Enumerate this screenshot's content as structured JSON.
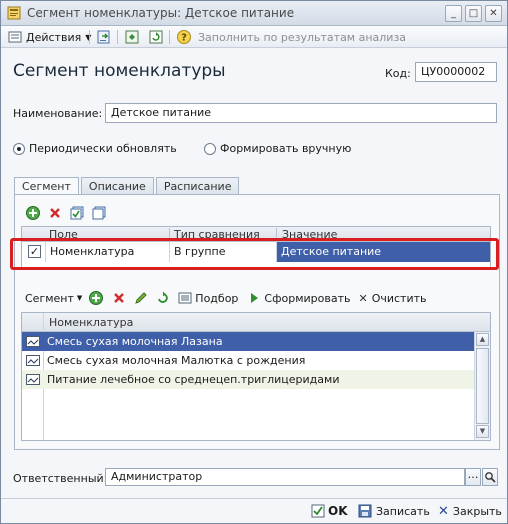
{
  "window": {
    "title": "Сегмент номенклатуры: Детское питание",
    "controls": [
      "minimize",
      "maximize",
      "close"
    ]
  },
  "toolbar": {
    "actions_label": "Действия",
    "fill_label": "Заполнить по результатам анализа"
  },
  "form": {
    "heading": "Сегмент номенклатуры",
    "code_label": "Код:",
    "code_value": "ЦУ0000002",
    "name_label": "Наименование:",
    "name_value": "Детское питание",
    "radio_periodic": "Периодически обновлять",
    "radio_manual": "Формировать вручную",
    "responsible_label": "Ответственный:",
    "responsible_value": "Администратор"
  },
  "tabs": [
    {
      "label": "Сегмент",
      "active": true
    },
    {
      "label": "Описание",
      "active": false
    },
    {
      "label": "Расписание",
      "active": false
    }
  ],
  "conditions": {
    "columns": [
      "Поле",
      "Тип сравнения",
      "Значение"
    ],
    "rows": [
      {
        "checked": true,
        "field": "Номенклатура",
        "comparison": "В группе",
        "value": "Детское питание"
      }
    ]
  },
  "segment_bar": {
    "segment_label": "Сегмент",
    "pick_label": "Подбор",
    "generate_label": "Сформировать",
    "clear_label": "Очистить"
  },
  "items": {
    "column": "Номенклатура",
    "rows": [
      {
        "name": "Смесь сухая молочная Лазана",
        "selected": true
      },
      {
        "name": "Смесь сухая молочная Малютка с рождения",
        "selected": false
      },
      {
        "name": "Питание лечебное со среднецеп.триглицеридами",
        "selected": false
      }
    ]
  },
  "footer": {
    "ok_label": "OK",
    "save_label": "Записать",
    "close_label": "Закрыть"
  },
  "colors": {
    "selection": "#3f5fa8",
    "highlight_box": "#d81e1e"
  }
}
